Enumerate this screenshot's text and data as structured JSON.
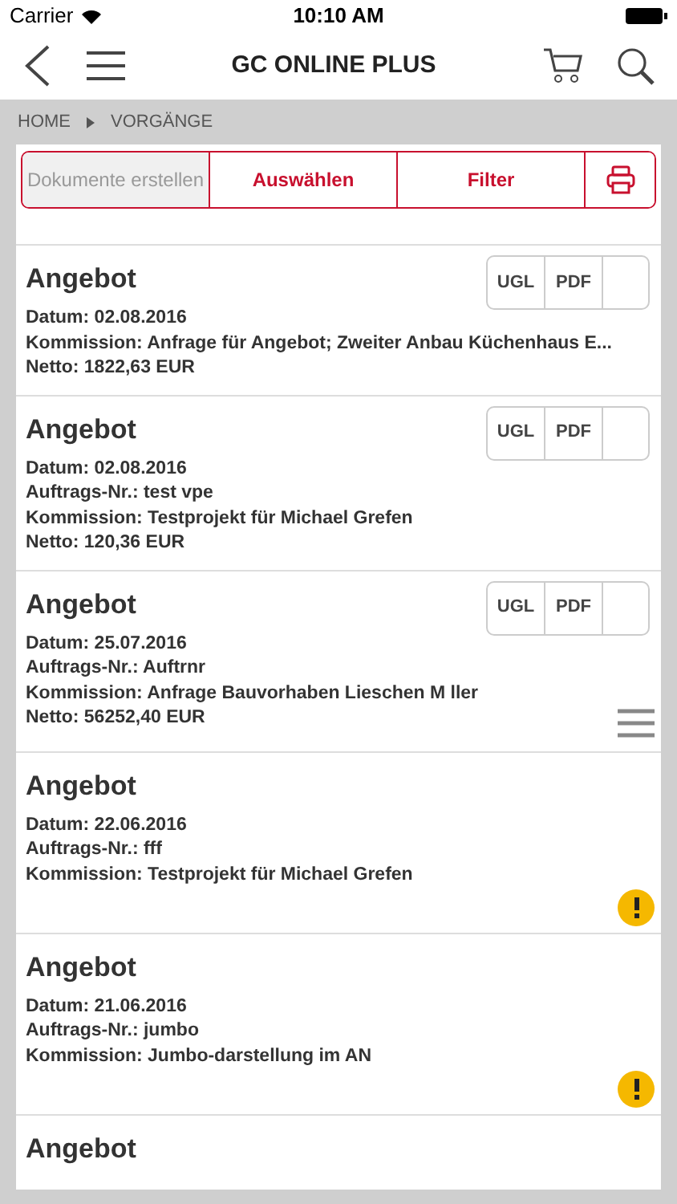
{
  "status_bar": {
    "carrier": "Carrier",
    "time": "10:10 AM"
  },
  "nav": {
    "title": "GC ONLINE PLUS"
  },
  "breadcrumb": [
    "HOME",
    "VORGÄNGE"
  ],
  "toolbar": [
    {
      "label": "Dokumente erstellen",
      "disabled": true
    },
    {
      "label": "Auswählen",
      "disabled": false
    },
    {
      "label": "Filter",
      "disabled": false
    }
  ],
  "items": [
    {
      "title": "Angebot",
      "lines": [
        "Datum: 02.08.2016",
        "Kommission: Anfrage für Angebot; Zweiter Anbau Küchenhaus E...",
        "Netto: 1822,63 EUR"
      ],
      "buttons": [
        "UGL",
        "PDF"
      ],
      "menu": false,
      "warning": false
    },
    {
      "title": "Angebot",
      "lines": [
        "Datum: 02.08.2016",
        "Auftrags-Nr.: test vpe",
        "Kommission: Testprojekt für Michael Grefen",
        "Netto: 120,36 EUR"
      ],
      "buttons": [
        "UGL",
        "PDF"
      ],
      "menu": false,
      "warning": false
    },
    {
      "title": "Angebot",
      "lines": [
        "Datum: 25.07.2016",
        "Auftrags-Nr.: Auftrnr",
        "Kommission: Anfrage Bauvorhaben Lieschen M ller",
        "Netto: 56252,40 EUR"
      ],
      "buttons": [
        "UGL",
        "PDF"
      ],
      "menu": true,
      "warning": false
    },
    {
      "title": "Angebot",
      "lines": [
        "Datum: 22.06.2016",
        "Auftrags-Nr.: fff",
        "Kommission: Testprojekt für Michael Grefen"
      ],
      "menu": false,
      "warning": true
    },
    {
      "title": "Angebot",
      "lines": [
        "Datum: 21.06.2016",
        "Auftrags-Nr.: jumbo",
        "Kommission: Jumbo-darstellung im AN"
      ],
      "menu": false,
      "warning": true
    },
    {
      "title": "Angebot",
      "menu": false,
      "warning": false
    }
  ]
}
